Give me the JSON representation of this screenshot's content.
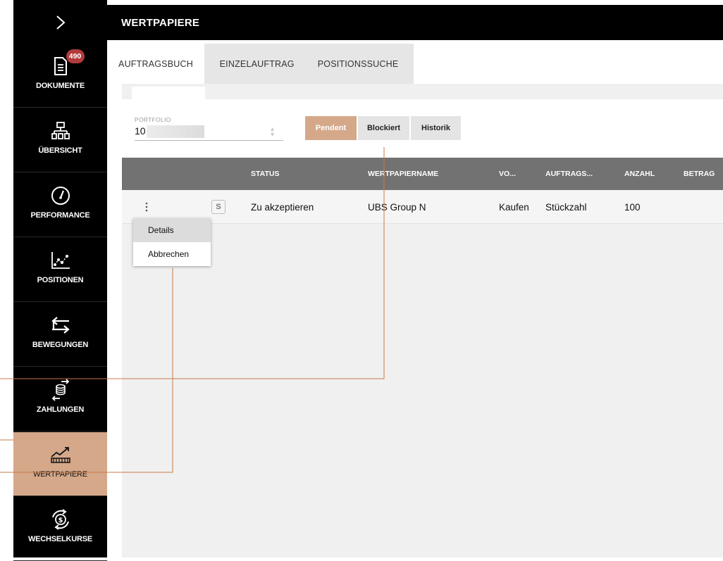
{
  "sidebar": {
    "items": [
      {
        "label": "DOKUMENTE",
        "icon": "document-icon",
        "badge": "490"
      },
      {
        "label": "ÜBERSICHT",
        "icon": "sitemap-icon"
      },
      {
        "label": "PERFORMANCE",
        "icon": "gauge-icon"
      },
      {
        "label": "POSITIONEN",
        "icon": "scatter-chart-icon"
      },
      {
        "label": "BEWEGUNGEN",
        "icon": "transfer-arrows-icon"
      },
      {
        "label": "ZAHLUNGEN",
        "icon": "coins-exchange-icon"
      },
      {
        "label": "WERTPAPIERE",
        "icon": "securities-chart-icon",
        "active": true
      },
      {
        "label": "WECHSELKURSE",
        "icon": "currency-exchange-icon"
      }
    ]
  },
  "header": {
    "title": "WERTPAPIERE"
  },
  "tabs": [
    "AUFTRAGSBUCH",
    "EINZELAUFTRAG",
    "POSITIONSSUCHE"
  ],
  "portfolio": {
    "label": "PORTFOLIO",
    "value": "10"
  },
  "filters": [
    "Pendent",
    "Blockiert",
    "Historik"
  ],
  "table": {
    "columns": [
      "STATUS",
      "WERTPAPIERNAME",
      "VO...",
      "AUFTRAGS...",
      "ANZAHL",
      "BETRAG"
    ],
    "rows": [
      {
        "type_badge": "S",
        "status": "Zu akzeptieren",
        "name": "UBS Group N",
        "direction": "Kaufen",
        "order_type": "Stückzahl",
        "quantity": "100",
        "amount": ""
      }
    ]
  },
  "row_menu": {
    "items": [
      "Details",
      "Abbrechen"
    ]
  },
  "colors": {
    "accent": "#d5a88a",
    "header_bg": "#000000",
    "table_header": "#727272",
    "badge": "#b23a3a",
    "callout_line": "#c87a4a"
  }
}
